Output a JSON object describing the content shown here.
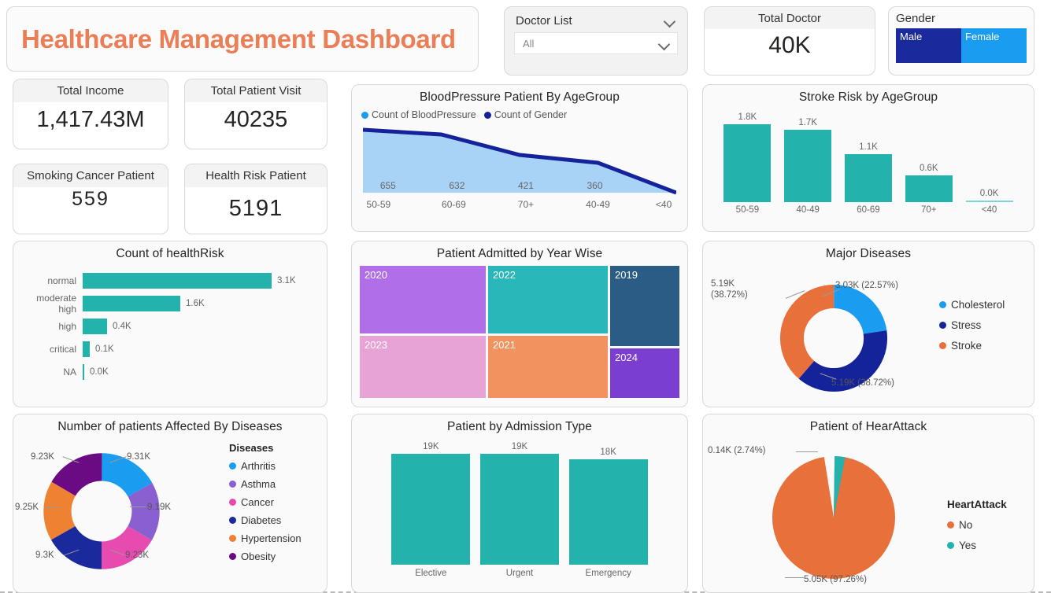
{
  "header": {
    "title": "Healthcare Management Dashboard",
    "title_color": "#ec7e57"
  },
  "doctor_slicer": {
    "label": "Doctor List",
    "value": "All",
    "chevron_icon": "chevron-down-icon"
  },
  "total_doctor": {
    "label": "Total Doctor",
    "value": "40K"
  },
  "gender_slicer": {
    "label": "Gender",
    "options": [
      {
        "label": "Male",
        "color": "#1a2a9c"
      },
      {
        "label": "Female",
        "color": "#1a9cf0"
      }
    ]
  },
  "kpis": [
    {
      "label": "Total Income",
      "value": "1,417.43M"
    },
    {
      "label": "Total Patient Visit",
      "value": "40235"
    },
    {
      "label": "Smoking Cancer Patient",
      "value": "559"
    },
    {
      "label": "Health Risk Patient",
      "value": "5191"
    }
  ],
  "colors": {
    "teal": "#23b3ac",
    "orange": "#e8703a",
    "blue": "#1a9cf0",
    "navy": "#15239b",
    "light_blue_fill": "#a8d3f7"
  },
  "chart_data": [
    {
      "id": "bloodpressure",
      "type": "area",
      "title": "BloodPressure Patient By AgeGroup",
      "legend": [
        {
          "name": "Count of BloodPressure",
          "color": "#1a9cf0"
        },
        {
          "name": "Count of Gender",
          "color": "#15239b"
        }
      ],
      "categories": [
        "50-59",
        "60-69",
        "70+",
        "40-49",
        "<40"
      ],
      "values": [
        655,
        632,
        421,
        360,
        0
      ],
      "labels": [
        "655",
        "632",
        "421",
        "360",
        ""
      ],
      "xlabel": "",
      "ylabel": "",
      "grid": false,
      "legend_position": "top-left"
    },
    {
      "id": "stroke_risk",
      "type": "bar",
      "title": "Stroke Risk by AgeGroup",
      "categories": [
        "50-59",
        "40-49",
        "60-69",
        "70+",
        "<40"
      ],
      "values": [
        1.8,
        1.7,
        1.1,
        0.6,
        0.0
      ],
      "labels": [
        "1.8K",
        "1.7K",
        "1.1K",
        "0.6K",
        "0.0K"
      ],
      "ylim": [
        0,
        2.0
      ],
      "grid": false,
      "color": "#23b3ac"
    },
    {
      "id": "health_risk",
      "type": "bar",
      "title": "Count of healthRisk",
      "orientation": "horizontal",
      "categories": [
        "normal",
        "moderate high",
        "high",
        "critical",
        "NA"
      ],
      "values": [
        3.1,
        1.6,
        0.4,
        0.1,
        0.0
      ],
      "labels": [
        "3.1K",
        "1.6K",
        "0.4K",
        "0.1K",
        "0.0K"
      ],
      "xlim": [
        0,
        3.1
      ],
      "grid": false,
      "color": "#23b3ac"
    },
    {
      "id": "patient_admitted_year",
      "type": "treemap",
      "title": "Patient Admitted by Year Wise",
      "tiles": [
        {
          "label": "2020",
          "color": "#b06fe8"
        },
        {
          "label": "2022",
          "color": "#2ab7ba"
        },
        {
          "label": "2019",
          "color": "#2b5c85"
        },
        {
          "label": "2023",
          "color": "#e8a3d6"
        },
        {
          "label": "2021",
          "color": "#f2925e"
        },
        {
          "label": "2024",
          "color": "#7a3fd0"
        }
      ]
    },
    {
      "id": "major_diseases",
      "type": "pie",
      "title": "Major Diseases",
      "donut": true,
      "legend_title": "",
      "slices": [
        {
          "name": "Cholesterol",
          "value": 3.03,
          "percent": 22.57,
          "label": "3.03K (22.57%)",
          "color": "#1a9cf0"
        },
        {
          "name": "Stress",
          "value": 5.19,
          "percent": 38.72,
          "label": "5.19K (38.72%)",
          "color": "#15239b"
        },
        {
          "name": "Stroke",
          "value": 5.19,
          "percent": 38.72,
          "label": "5.19K\n(38.72%)",
          "color": "#e8703a"
        }
      ],
      "legend_position": "right"
    },
    {
      "id": "patients_by_disease",
      "type": "pie",
      "title": "Number of patients Affected By Diseases",
      "donut": true,
      "legend_title": "Diseases",
      "slices": [
        {
          "name": "Arthritis",
          "value": 9.31,
          "label": "9.31K",
          "color": "#1a9cf0"
        },
        {
          "name": "Asthma",
          "value": 9.19,
          "label": "9.19K",
          "color": "#8a5fd0"
        },
        {
          "name": "Cancer",
          "value": 9.23,
          "label": "9.23K",
          "color": "#e84bb0"
        },
        {
          "name": "Diabetes",
          "value": 9.3,
          "label": "9.3K",
          "color": "#1a2a9c"
        },
        {
          "name": "Hypertension",
          "value": 9.25,
          "label": "9.25K",
          "color": "#ef8133"
        },
        {
          "name": "Obesity",
          "value": 9.23,
          "label": "9.23K",
          "color": "#6b0b84"
        }
      ],
      "legend_position": "right"
    },
    {
      "id": "admission_type",
      "type": "bar",
      "title": "Patient by Admission Type",
      "categories": [
        "Elective",
        "Urgent",
        "Emergency"
      ],
      "values": [
        19,
        19,
        18
      ],
      "labels": [
        "19K",
        "19K",
        "18K"
      ],
      "ylim": [
        0,
        19
      ],
      "grid": false,
      "color": "#23b3ac"
    },
    {
      "id": "heart_attack",
      "type": "pie",
      "title": "Patient of HearAttack",
      "donut": false,
      "legend_title": "HeartAttack",
      "slices": [
        {
          "name": "No",
          "value": 5.05,
          "percent": 97.26,
          "label": "5.05K (97.26%)",
          "color": "#e8703a"
        },
        {
          "name": "Yes",
          "value": 0.14,
          "percent": 2.74,
          "label": "0.14K (2.74%)",
          "color": "#23b3ac"
        }
      ],
      "legend_position": "right"
    }
  ]
}
